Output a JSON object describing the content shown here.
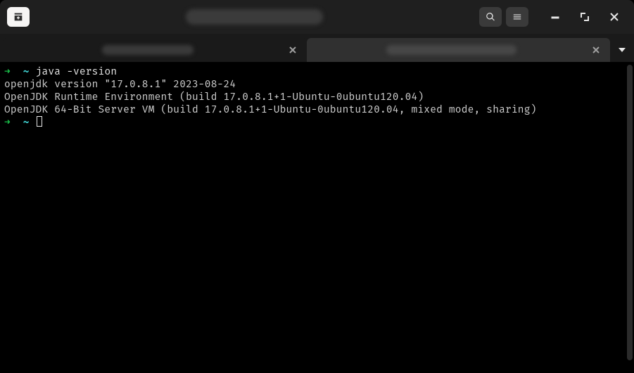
{
  "titlebar": {
    "title_width": 195
  },
  "tabs": [
    {
      "active": false,
      "title_width": 130
    },
    {
      "active": true,
      "title_width": 185
    }
  ],
  "terminal": {
    "prompt_arrow": "➜",
    "prompt_path": "~",
    "command1": "java -version",
    "output1": "openjdk version \"17.0.8.1\" 2023-08-24",
    "output2": "OpenJDK Runtime Environment (build 17.0.8.1+1-Ubuntu-0ubuntu120.04)",
    "output3": "OpenJDK 64-Bit Server VM (build 17.0.8.1+1-Ubuntu-0ubuntu120.04, mixed mode, sharing)"
  }
}
